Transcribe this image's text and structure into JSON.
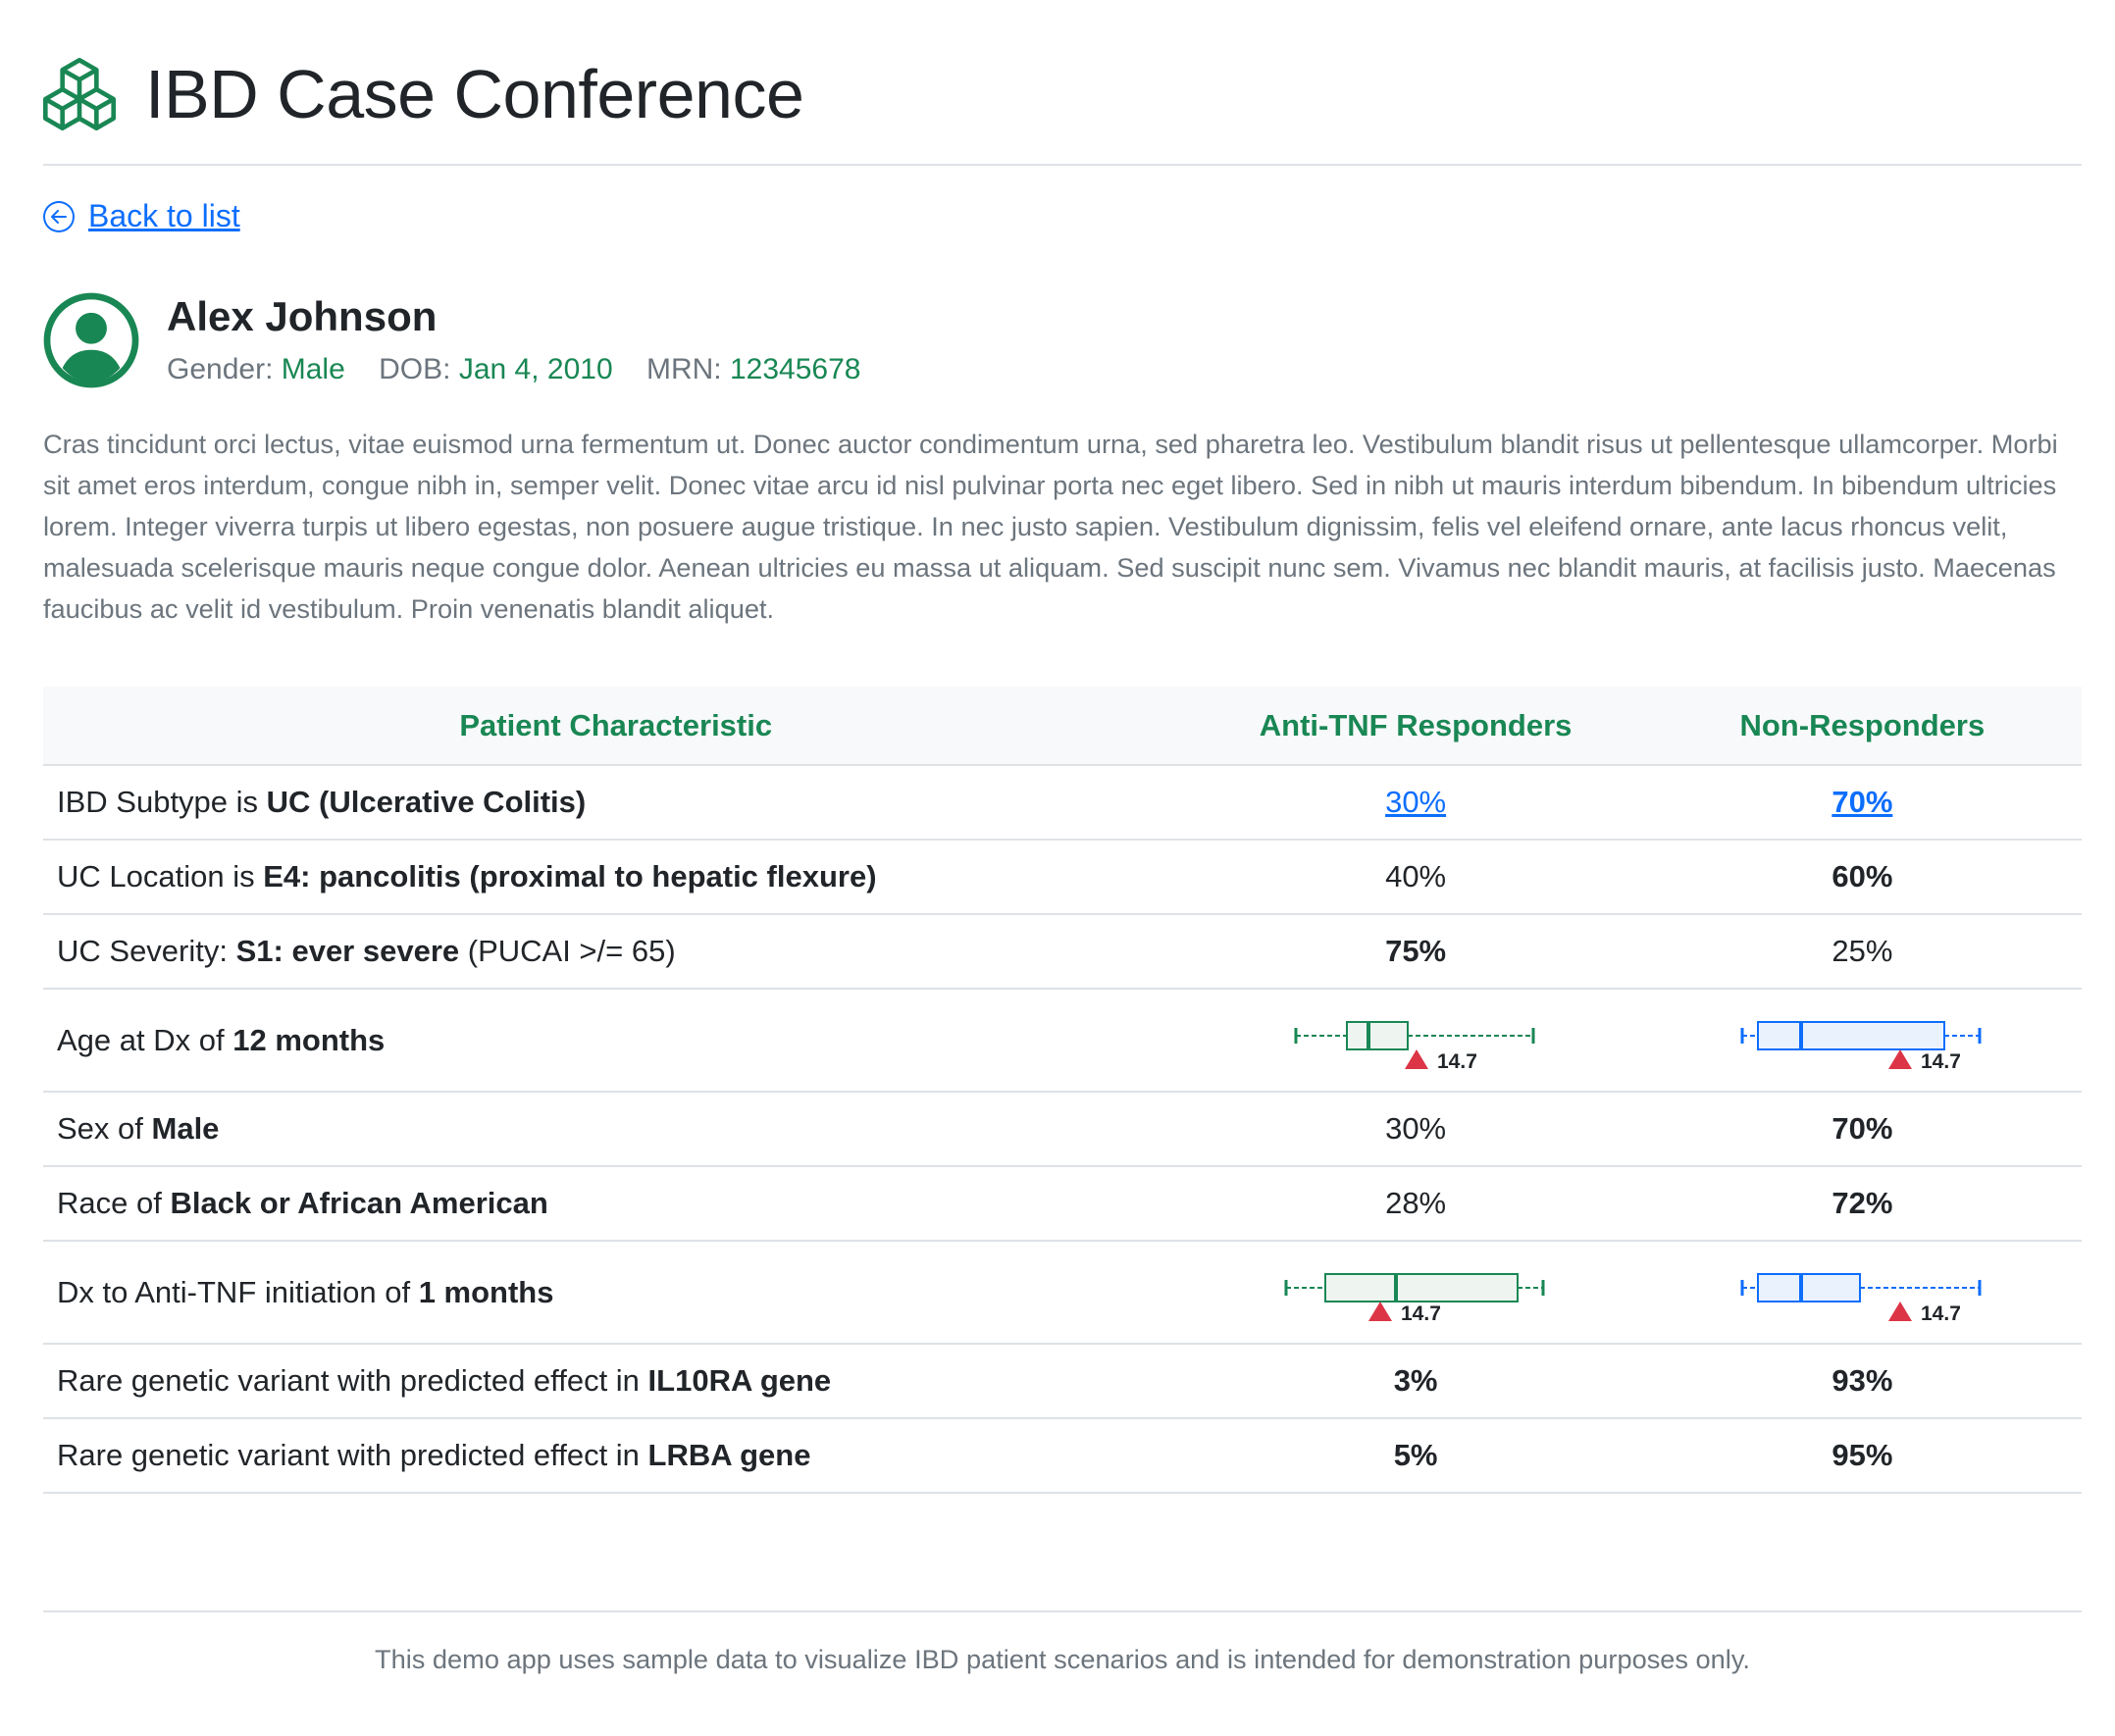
{
  "app": {
    "title": "IBD Case Conference",
    "logo_icon": "boxes-icon",
    "accent": "#198754",
    "link_color": "#0d6efd"
  },
  "nav": {
    "back_label": "Back to list",
    "back_icon": "arrow-left-circle-icon"
  },
  "patient": {
    "name": "Alex Johnson",
    "gender_label": "Gender:",
    "gender": "Male",
    "dob_label": "DOB:",
    "dob": "Jan 4, 2010",
    "mrn_label": "MRN:",
    "mrn": "12345678",
    "avatar_icon": "person-circle-icon",
    "description": "Cras tincidunt orci lectus, vitae euismod urna fermentum ut. Donec auctor condimentum urna, sed pharetra leo. Vestibulum blandit risus ut pellentesque ullamcorper. Morbi sit amet eros interdum, congue nibh in, semper velit. Donec vitae arcu id nisl pulvinar porta nec eget libero. Sed in nibh ut mauris interdum bibendum. In bibendum ultricies lorem. Integer viverra turpis ut libero egestas, non posuere augue tristique. In nec justo sapien. Vestibulum dignissim, felis vel eleifend ornare, ante lacus rhoncus velit, malesuada scelerisque mauris neque congue dolor. Aenean ultricies eu massa ut aliquam. Sed suscipit nunc sem. Vivamus nec blandit mauris, at facilisis justo. Maecenas faucibus ac velit id vestibulum. Proin venenatis blandit aliquet."
  },
  "table": {
    "headers": [
      "Patient Characteristic",
      "Anti-TNF Responders",
      "Non-Responders"
    ],
    "rows": [
      {
        "pre": "IBD Subtype is ",
        "bold": "UC (Ulcerative Colitis)",
        "post": "",
        "responders": "30%",
        "non_responders": "70%",
        "responders_bold": false,
        "non_responders_bold": true,
        "linked": true
      },
      {
        "pre": "UC Location is ",
        "bold": "E4: pancolitis (proximal to hepatic flexure)",
        "post": "",
        "responders": "40%",
        "non_responders": "60%",
        "responders_bold": false,
        "non_responders_bold": true
      },
      {
        "pre": "UC Severity: ",
        "bold": "S1: ever severe",
        "post": " (PUCAI >/= 65)",
        "responders": "75%",
        "non_responders": "25%",
        "responders_bold": true,
        "non_responders_bold": false
      },
      {
        "pre": "Age at Dx of ",
        "bold": "12 months",
        "post": "",
        "boxplot": true,
        "marker_label_responders": "14.7",
        "marker_label_non_responders": "14.7"
      },
      {
        "pre": "Sex of ",
        "bold": "Male",
        "post": "",
        "responders": "30%",
        "non_responders": "70%",
        "responders_bold": false,
        "non_responders_bold": true
      },
      {
        "pre": "Race of ",
        "bold": "Black or African American",
        "post": "",
        "responders": "28%",
        "non_responders": "72%",
        "responders_bold": false,
        "non_responders_bold": true
      },
      {
        "pre": "Dx to Anti-TNF initiation of ",
        "bold": "1 months",
        "post": "",
        "boxplot": true,
        "marker_label_responders": "14.7",
        "marker_label_non_responders": "14.7"
      },
      {
        "pre": "Rare genetic variant with predicted effect in ",
        "bold": "IL10RA gene",
        "post": "",
        "responders": "3%",
        "non_responders": "93%",
        "responders_bold": true,
        "non_responders_bold": true
      },
      {
        "pre": "Rare genetic variant with predicted effect in ",
        "bold": "LRBA gene",
        "post": "",
        "responders": "5%",
        "non_responders": "95%",
        "responders_bold": true,
        "non_responders_bold": true
      }
    ]
  },
  "footer": {
    "text": "This demo app uses sample data to visualize IBD patient scenarios and is intended for demonstration purposes only."
  },
  "boxplot_colors": {
    "responders": "#198754",
    "non_responders": "#0d6efd",
    "marker": "#dc3545"
  }
}
